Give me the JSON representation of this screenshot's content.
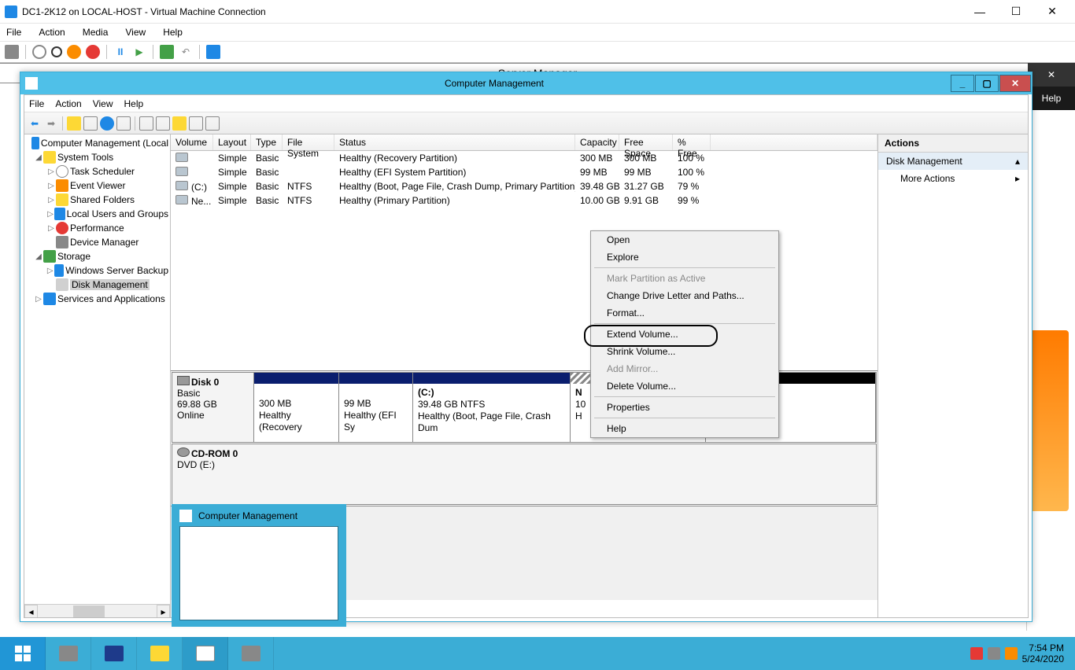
{
  "hv": {
    "title": "DC1-2K12 on LOCAL-HOST - Virtual Machine Connection",
    "menu": [
      "File",
      "Action",
      "Media",
      "View",
      "Help"
    ]
  },
  "sm": {
    "title": "Server Manager",
    "close_x": "✕",
    "help": "Help"
  },
  "cm": {
    "title": "Computer Management",
    "menu": [
      "File",
      "Action",
      "View",
      "Help"
    ],
    "tree": {
      "root": "Computer Management (Local",
      "system_tools": "System Tools",
      "task_scheduler": "Task Scheduler",
      "event_viewer": "Event Viewer",
      "shared_folders": "Shared Folders",
      "local_users": "Local Users and Groups",
      "performance": "Performance",
      "device_manager": "Device Manager",
      "storage": "Storage",
      "server_backup": "Windows Server Backup",
      "disk_management": "Disk Management",
      "services_apps": "Services and Applications"
    },
    "cols": {
      "volume": "Volume",
      "layout": "Layout",
      "type": "Type",
      "fs": "File System",
      "status": "Status",
      "capacity": "Capacity",
      "free": "Free Space",
      "pct": "% Free"
    },
    "rows": [
      {
        "vol": "",
        "layout": "Simple",
        "type": "Basic",
        "fs": "",
        "status": "Healthy (Recovery Partition)",
        "cap": "300 MB",
        "free": "300 MB",
        "pct": "100 %"
      },
      {
        "vol": "",
        "layout": "Simple",
        "type": "Basic",
        "fs": "",
        "status": "Healthy (EFI System Partition)",
        "cap": "99 MB",
        "free": "99 MB",
        "pct": "100 %"
      },
      {
        "vol": "(C:)",
        "layout": "Simple",
        "type": "Basic",
        "fs": "NTFS",
        "status": "Healthy (Boot, Page File, Crash Dump, Primary Partition)",
        "cap": "39.48 GB",
        "free": "31.27 GB",
        "pct": "79 %"
      },
      {
        "vol": "Ne...",
        "layout": "Simple",
        "type": "Basic",
        "fs": "NTFS",
        "status": "Healthy (Primary Partition)",
        "cap": "10.00 GB",
        "free": "9.91 GB",
        "pct": "99 %"
      }
    ],
    "disk0": {
      "name": "Disk 0",
      "type": "Basic",
      "size": "69.88 GB",
      "state": "Online",
      "p1_size": "300 MB",
      "p1_state": "Healthy (Recovery",
      "p2_size": "99 MB",
      "p2_state": "Healthy (EFI Sy",
      "p3_name": "(C:)",
      "p3_size": "39.48 GB NTFS",
      "p3_state": "Healthy (Boot, Page File, Crash Dum",
      "p4_name": "N",
      "p4_size": "10",
      "p4_state": "H"
    },
    "cdrom": {
      "name": "CD-ROM 0",
      "sub": "DVD (E:)"
    },
    "actions": {
      "hdr": "Actions",
      "dm": "Disk Management",
      "more": "More Actions"
    },
    "ctx": {
      "open": "Open",
      "explore": "Explore",
      "mark": "Mark Partition as Active",
      "change": "Change Drive Letter and Paths...",
      "format": "Format...",
      "extend": "Extend Volume...",
      "shrink": "Shrink Volume...",
      "mirror": "Add Mirror...",
      "delete": "Delete Volume...",
      "props": "Properties",
      "help": "Help"
    }
  },
  "thumb": {
    "title": "Computer Management"
  },
  "tray": {
    "time": "7:54 PM",
    "date": "5/24/2020"
  }
}
